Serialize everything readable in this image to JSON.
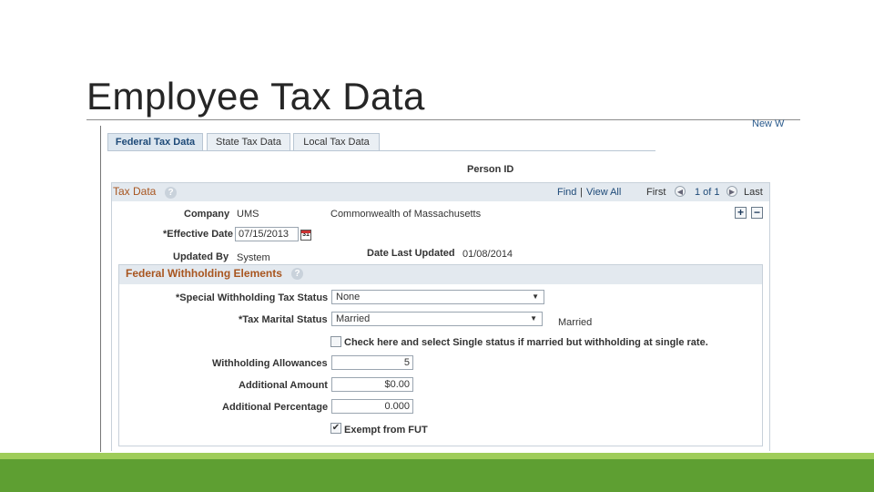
{
  "slide": {
    "title": "Employee Tax Data"
  },
  "page": {
    "new_window": "New W"
  },
  "tabs": [
    {
      "label": "Federal Tax Data",
      "active": true
    },
    {
      "label": "State Tax Data",
      "active": false
    },
    {
      "label": "Local Tax Data",
      "active": false
    }
  ],
  "person_id": {
    "label": "Person ID",
    "value": ""
  },
  "tax_data": {
    "header": "Tax Data",
    "help": "?",
    "find": "Find",
    "separator": "|",
    "view_all": "View All",
    "first": "First",
    "prev_icon": "◀",
    "count": "1 of 1",
    "next_icon": "▶",
    "last": "Last",
    "add_button": "+",
    "remove_button": "−",
    "company_label": "Company",
    "company_value": "UMS",
    "company_desc": "Commonwealth of Massachusetts",
    "effective_date_label": "*Effective Date",
    "effective_date_value": "07/15/2013",
    "calendar_icon": "31",
    "updated_by_label": "Updated By",
    "updated_by_value": "System",
    "date_last_updated_label": "Date Last Updated",
    "date_last_updated_value": "01/08/2014"
  },
  "fwe": {
    "header": "Federal Withholding Elements",
    "help": "?",
    "special_status_label": "*Special Withholding Tax Status",
    "special_status_value": "None",
    "marital_label": "*Tax Marital Status",
    "marital_value": "Married",
    "marital_desc": "Married",
    "single_rate_label": "Check here and select Single status if married but withholding at single rate.",
    "single_rate_checked": false,
    "allowances_label": "Withholding Allowances",
    "allowances_value": "5",
    "additional_amount_label": "Additional Amount",
    "additional_amount_value": "$0.00",
    "additional_percentage_label": "Additional Percentage",
    "additional_percentage_value": "0.000",
    "exempt_fut_label": "Exempt from FUT",
    "exempt_fut_checked": true,
    "check_mark": "✔",
    "caret": "▼"
  },
  "colors": {
    "accent_green_light": "#9fcd5a",
    "accent_green_dark": "#5e9f32",
    "section_title": "#a8551f",
    "link": "#1e4a78"
  }
}
